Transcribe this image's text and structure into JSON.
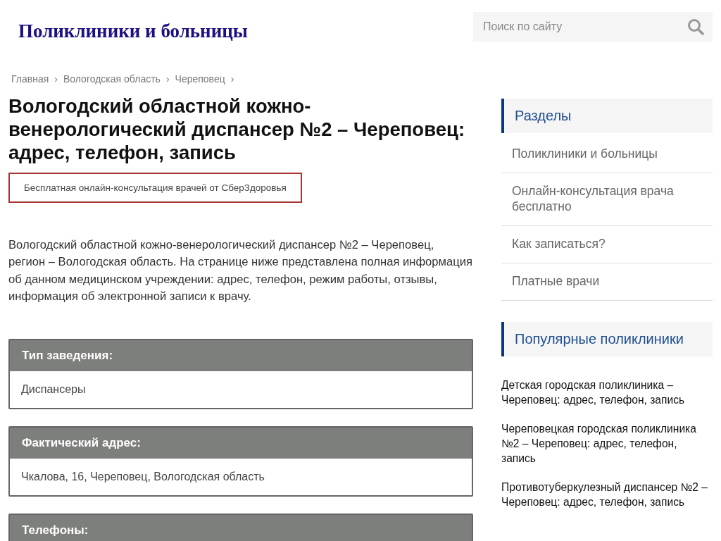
{
  "site_title": "Поликлиники и больницы",
  "search": {
    "placeholder": "Поиск по сайту"
  },
  "breadcrumbs": [
    "Главная",
    "Вологодская область",
    "Череповец"
  ],
  "separator": "›",
  "page_title": "Вологодский областной кожно-венерологический диспансер №2 – Череповец: адрес, телефон, запись",
  "promo_link": "Бесплатная онлайн-консультация врачей от СберЗдоровья",
  "intro": "Вологодский областной кожно-венерологический диспансер №2 – Череповец, регион – Вологодская область. На странице ниже представлена полная информация об данном медицинском учреждении: адрес, телефон, режим работы, отзывы, информация об электронной записи к врачу.",
  "info_cards": [
    {
      "label": "Тип заведения:",
      "value": "Диспансеры"
    },
    {
      "label": "Фактический адрес:",
      "value": "Чкалова, 16, Череповец, Вологодская область"
    },
    {
      "label": "Телефоны:"
    }
  ],
  "sidebar": {
    "sections_title": "Разделы",
    "sections": [
      "Поликлиники и больницы",
      "Онлайн-консультация врача бесплатно",
      "Как записаться?",
      "Платные врачи"
    ],
    "popular_title": "Популярные поликлиники",
    "popular": [
      "Детская городская поликлиника – Череповец: адрес, телефон, запись",
      "Череповецкая городская поликлиника №2 – Череповец: адрес, телефон, запись",
      "Противотуберкулезный диспансер №2 – Череповец: адрес, телефон, запись"
    ]
  }
}
